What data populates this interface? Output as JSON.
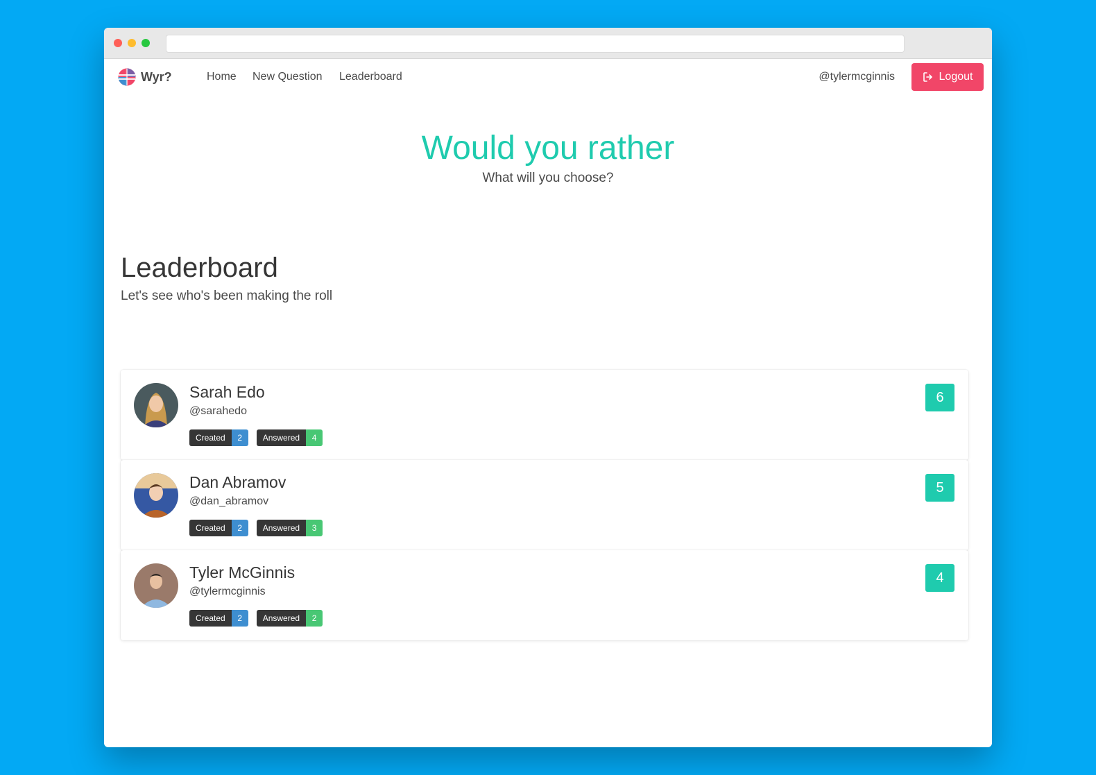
{
  "navbar": {
    "brand": "Wyr?",
    "links": [
      "Home",
      "New Question",
      "Leaderboard"
    ],
    "user_handle": "@tylermcginnis",
    "logout_label": "Logout"
  },
  "hero": {
    "title": "Would you rather",
    "subtitle": "What will you choose?"
  },
  "leaderboard": {
    "title": "Leaderboard",
    "subtitle": "Let's see who's been making the roll",
    "created_label": "Created",
    "answered_label": "Answered",
    "entries": [
      {
        "name": "Sarah Edo",
        "handle": "@sarahedo",
        "created": "2",
        "answered": "4",
        "score": "6"
      },
      {
        "name": "Dan Abramov",
        "handle": "@dan_abramov",
        "created": "2",
        "answered": "3",
        "score": "5"
      },
      {
        "name": "Tyler McGinnis",
        "handle": "@tylermcginnis",
        "created": "2",
        "answered": "2",
        "score": "4"
      }
    ]
  },
  "colors": {
    "accent": "#1fcbae",
    "logout": "#f14668",
    "tag_blue": "#3e8ed0",
    "tag_green": "#48c774",
    "background": "#03a9f4"
  }
}
